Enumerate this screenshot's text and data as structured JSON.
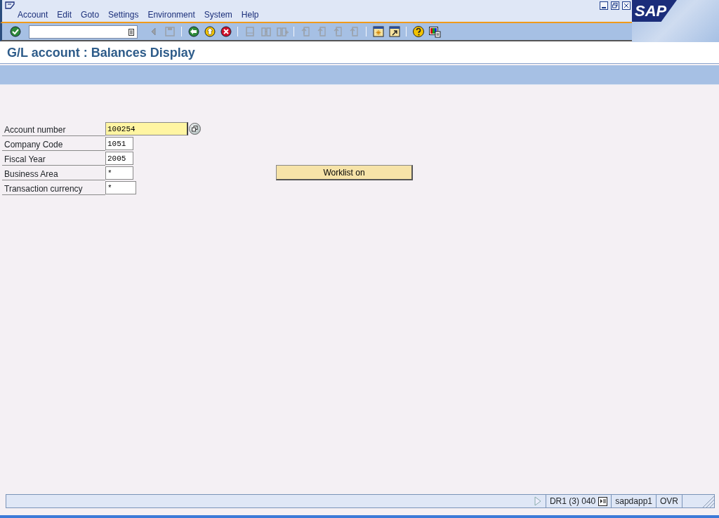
{
  "menu": [
    {
      "label": "Account"
    },
    {
      "label": "Edit"
    },
    {
      "label": "Goto"
    },
    {
      "label": "Settings"
    },
    {
      "label": "Environment"
    },
    {
      "label": "System"
    },
    {
      "label": "Help"
    }
  ],
  "logo": {
    "text": "SAP"
  },
  "toolbar": [
    {
      "kind": "enter",
      "disabled": false
    },
    {
      "kind": "command"
    },
    {
      "kind": "flag",
      "disabled": true
    },
    {
      "kind": "save",
      "disabled": true
    },
    {
      "kind": "sep"
    },
    {
      "kind": "back",
      "disabled": false
    },
    {
      "kind": "exit",
      "disabled": false
    },
    {
      "kind": "cancel",
      "disabled": false
    },
    {
      "kind": "sep"
    },
    {
      "kind": "print",
      "disabled": true
    },
    {
      "kind": "find",
      "disabled": true
    },
    {
      "kind": "findnext",
      "disabled": true
    },
    {
      "kind": "sep"
    },
    {
      "kind": "page",
      "disabled": true
    },
    {
      "kind": "page",
      "disabled": true
    },
    {
      "kind": "page",
      "disabled": true
    },
    {
      "kind": "page",
      "disabled": true
    },
    {
      "kind": "sep"
    },
    {
      "kind": "session",
      "disabled": false
    },
    {
      "kind": "shortcut",
      "disabled": false
    },
    {
      "kind": "sep"
    },
    {
      "kind": "help",
      "disabled": false
    },
    {
      "kind": "layout",
      "disabled": false
    }
  ],
  "title": "G/L account : Balances Display",
  "fields": [
    {
      "label": "Account number",
      "value": "100254",
      "focused": true,
      "search_help": true
    },
    {
      "label": "Company Code",
      "value": "1051",
      "focused": false,
      "search_help": false
    },
    {
      "label": "Fiscal Year",
      "value": "2005",
      "focused": false,
      "search_help": false
    },
    {
      "label": "Business Area",
      "value": "*",
      "focused": false,
      "search_help": false
    },
    {
      "label": "Transaction currency",
      "value": "*",
      "focused": false,
      "search_help": false
    }
  ],
  "worklist_button": {
    "label": "Worklist on"
  },
  "status_bar": {
    "system": "DR1 (3) 040",
    "server": "sapdapp1",
    "mode": "OVR"
  }
}
